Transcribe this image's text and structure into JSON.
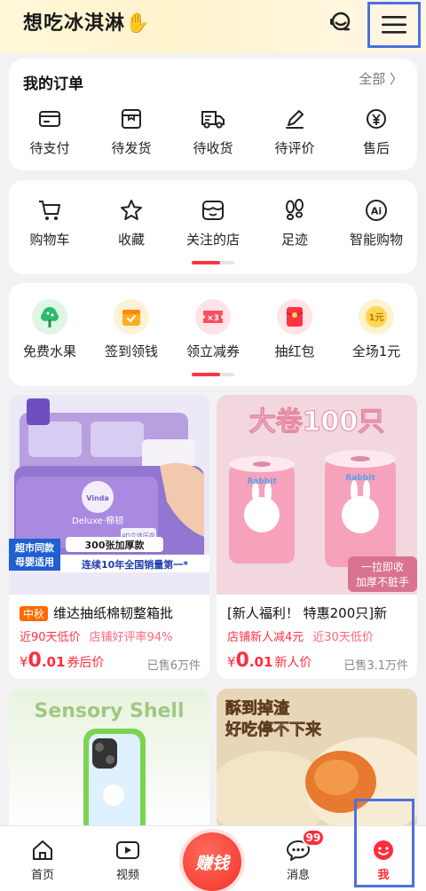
{
  "header": {
    "username": "想吃冰淇淋",
    "hand_glyph": "✋"
  },
  "orders": {
    "title": "我的订单",
    "all_link": "全部 〉",
    "items": [
      {
        "label": "待支付",
        "icon": "wallet-icon"
      },
      {
        "label": "待发货",
        "icon": "package-icon"
      },
      {
        "label": "待收货",
        "icon": "truck-icon"
      },
      {
        "label": "待评价",
        "icon": "pen-icon"
      },
      {
        "label": "售后",
        "icon": "yen-service-icon"
      }
    ]
  },
  "tools": {
    "items": [
      {
        "label": "购物车",
        "icon": "cart-icon"
      },
      {
        "label": "收藏",
        "icon": "star-icon"
      },
      {
        "label": "关注的店",
        "icon": "store-icon"
      },
      {
        "label": "足迹",
        "icon": "footprint-icon"
      },
      {
        "label": "智能购物",
        "icon": "ai-icon"
      }
    ]
  },
  "services": {
    "items": [
      {
        "label": "免费水果",
        "icon": "tree-icon",
        "color": "#2dbb6e",
        "bg": "#dff6e7"
      },
      {
        "label": "签到领钱",
        "icon": "signin-icon",
        "color": "#ffae1f",
        "bg": "#fff1d8"
      },
      {
        "label": "领立减券",
        "icon": "coupon-icon",
        "color": "#ff4d5e",
        "bg": "#ffe3e6"
      },
      {
        "label": "抽红包",
        "icon": "redpacket-icon",
        "color": "#ff3344",
        "bg": "#ffe3e6"
      },
      {
        "label": "全场1元",
        "icon": "one-yuan-icon",
        "color": "#f5b400",
        "bg": "#fff3cf",
        "icon_text": "1元"
      }
    ]
  },
  "products": [
    {
      "tag": "中秋",
      "title": "维达抽纸棉韧整箱批",
      "sub1": "近90天低价",
      "sub2": "店铺好评率94%",
      "price_int": "0",
      "price_dec": ".01",
      "price_note": "券后价",
      "sold": "已售6万件",
      "image": {
        "banner1": "超市同款",
        "banner2": "母婴适用",
        "ribbon1": "300张加厚款",
        "ribbon2": "连续10年全国销量第一*",
        "brand": "Vinda",
        "pack_label": "Deluxe·棉韧",
        "pack_sub": "4D立体压花"
      }
    },
    {
      "title": "[新人福利！ 特惠200只]新",
      "sub1": "店铺新人减4元",
      "sub2": "近30天低价",
      "price_int": "0",
      "price_dec": ".01",
      "price_note": "新人价",
      "sold": "已售3.1万件",
      "image": {
        "headline": "大卷100只",
        "roll_label": "Rabbit",
        "tag1": "一拉即收",
        "tag2": "加厚不脏手"
      }
    },
    {
      "image": {
        "headline": "Sensory Shell"
      }
    },
    {
      "image": {
        "line1": "酥到掉渣",
        "line2": "好吃停不下来"
      }
    }
  ],
  "tabbar": {
    "items": [
      {
        "label": "首页",
        "icon": "home-icon"
      },
      {
        "label": "视频",
        "icon": "video-icon"
      },
      {
        "label": "赚钱",
        "icon": "earn-button"
      },
      {
        "label": "消息",
        "icon": "message-icon",
        "badge": "99"
      },
      {
        "label": "我",
        "icon": "me-icon"
      }
    ]
  },
  "colors": {
    "accent": "#ff2d3c",
    "highlight_box": "#4d6fe0"
  }
}
